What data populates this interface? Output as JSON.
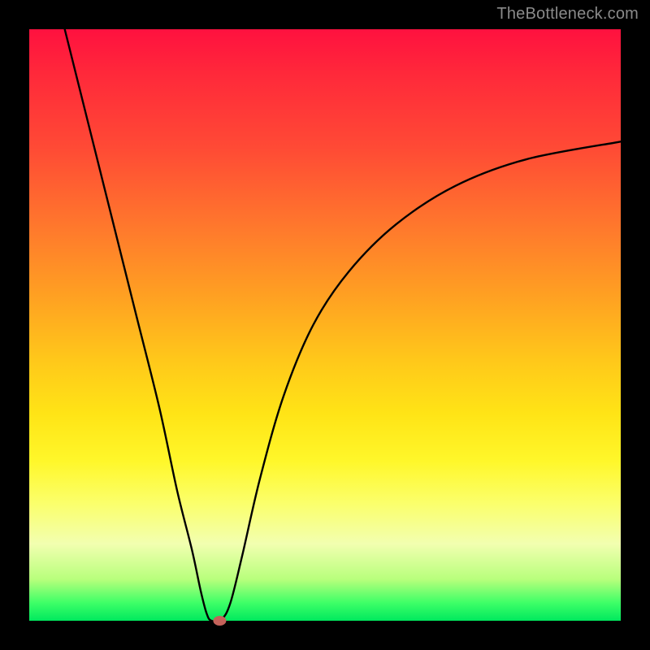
{
  "attribution": "TheBottleneck.com",
  "accent_marker_color": "#c4625a",
  "gradient_stops": [
    "#ff113f",
    "#ffa022",
    "#fff72a",
    "#00e85e"
  ],
  "chart_data": {
    "type": "line",
    "title": "",
    "xlabel": "",
    "ylabel": "",
    "xlim": [
      0,
      100
    ],
    "ylim": [
      0,
      100
    ],
    "x": [
      6,
      10,
      14,
      18,
      22,
      25,
      27.5,
      29,
      30,
      30.8,
      32.5,
      34,
      36,
      39,
      43,
      48,
      54,
      62,
      72,
      84,
      100
    ],
    "values": [
      100,
      84,
      68,
      52,
      36,
      22,
      12,
      5,
      1.2,
      0,
      0.2,
      3,
      11,
      24,
      38,
      50,
      59,
      67,
      73.5,
      78,
      81
    ],
    "marker": {
      "x": 32.2,
      "y": 0
    },
    "notes": "Values are read off the rendered curve as percentage of plot height (0 = bottom/green, 100 = top/red). No axis ticks or numeric labels are present in the image; all values are visual estimates."
  }
}
